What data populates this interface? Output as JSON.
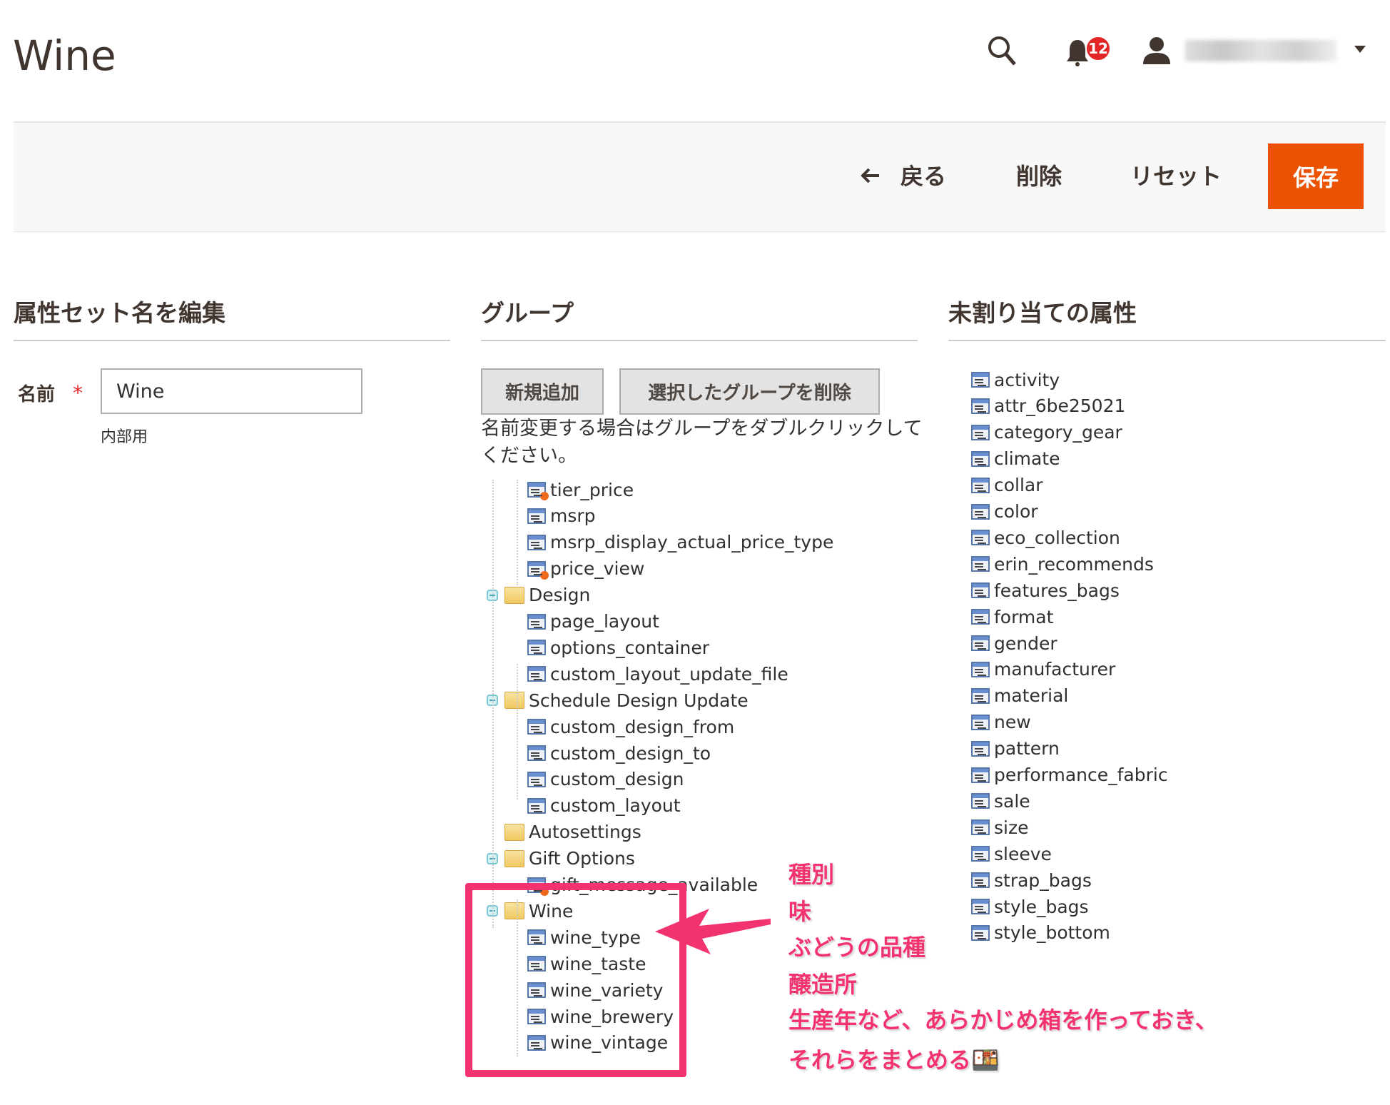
{
  "header": {
    "title": "Wine",
    "notification_count": "12",
    "user_name": "████████"
  },
  "actions": {
    "back": "戻る",
    "delete": "削除",
    "reset": "リセット",
    "save": "保存",
    "save_color": "#eb5202"
  },
  "edit_section": {
    "heading": "属性セット名を編集",
    "name_label": "名前",
    "required_mark": "*",
    "name_value": "Wine",
    "name_hint": "内部用"
  },
  "groups_section": {
    "heading": "グループ",
    "add_button": "新規追加",
    "delete_button": "選択したグループを削除",
    "help_text": "名前変更する場合はグループをダブルクリックしてください。",
    "tree": [
      {
        "label": "tier_price",
        "type": "attr",
        "system": true
      },
      {
        "label": "msrp",
        "type": "attr"
      },
      {
        "label": "msrp_display_actual_price_type",
        "type": "attr"
      },
      {
        "label": "price_view",
        "type": "attr",
        "system": true
      },
      {
        "label": "Design",
        "type": "group",
        "expanded": true
      },
      {
        "label": "page_layout",
        "type": "attr"
      },
      {
        "label": "options_container",
        "type": "attr"
      },
      {
        "label": "custom_layout_update_file",
        "type": "attr"
      },
      {
        "label": "Schedule Design Update",
        "type": "group",
        "expanded": true
      },
      {
        "label": "custom_design_from",
        "type": "attr"
      },
      {
        "label": "custom_design_to",
        "type": "attr"
      },
      {
        "label": "custom_design",
        "type": "attr"
      },
      {
        "label": "custom_layout",
        "type": "attr"
      },
      {
        "label": "Autosettings",
        "type": "group",
        "expanded": false
      },
      {
        "label": "Gift Options",
        "type": "group",
        "expanded": true
      },
      {
        "label": "gift_message_available",
        "type": "attr",
        "system": true
      },
      {
        "label": "Wine",
        "type": "group",
        "expanded": true
      },
      {
        "label": "wine_type",
        "type": "attr"
      },
      {
        "label": "wine_taste",
        "type": "attr"
      },
      {
        "label": "wine_variety",
        "type": "attr"
      },
      {
        "label": "wine_brewery",
        "type": "attr"
      },
      {
        "label": "wine_vintage",
        "type": "attr"
      }
    ]
  },
  "unassigned_section": {
    "heading": "未割り当ての属性",
    "items": [
      "activity",
      "attr_6be25021",
      "category_gear",
      "climate",
      "collar",
      "color",
      "eco_collection",
      "erin_recommends",
      "features_bags",
      "format",
      "gender",
      "manufacturer",
      "material",
      "new",
      "pattern",
      "performance_fabric",
      "sale",
      "size",
      "sleeve",
      "strap_bags",
      "style_bags",
      "style_bottom"
    ]
  },
  "annotation": {
    "color": "#f2336f",
    "lines": [
      "種別",
      "味",
      "ぶどうの品種",
      "醸造所",
      "生産年など、あらかじめ箱を作っておき、",
      "それらをまとめる🍱"
    ]
  }
}
